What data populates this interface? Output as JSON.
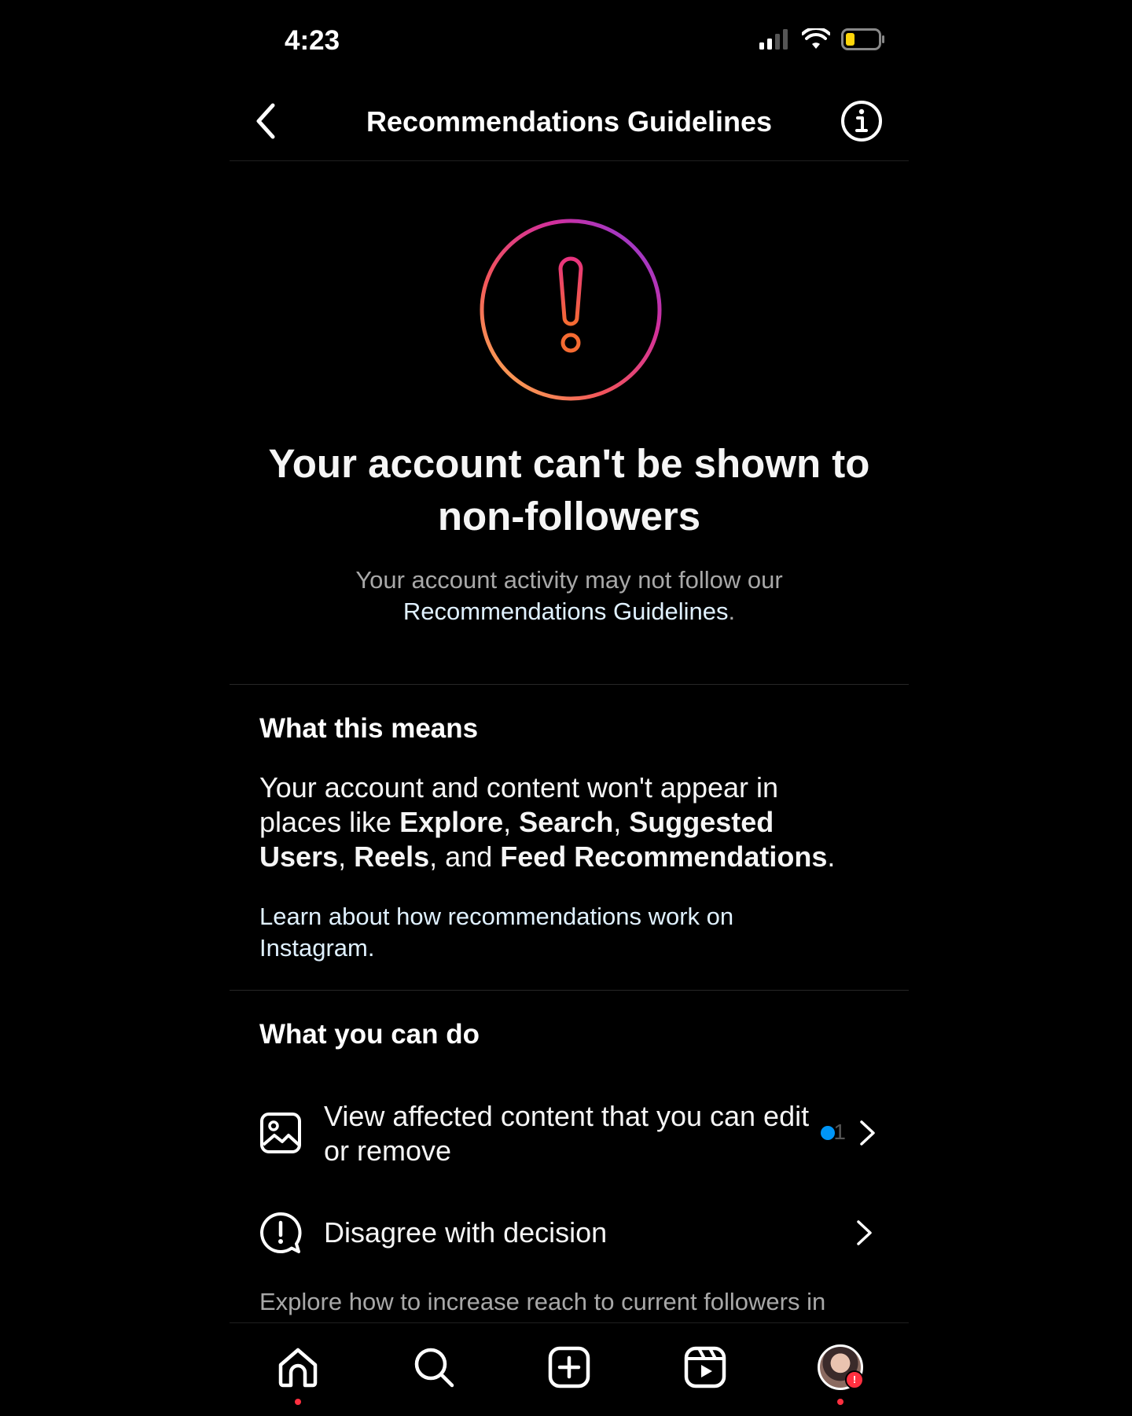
{
  "status_bar": {
    "time": "4:23"
  },
  "header": {
    "title": "Recommendations Guidelines"
  },
  "hero": {
    "title": "Your account can't be shown to non-followers",
    "subtitle_prefix": "Your account activity may not follow our",
    "subtitle_link": "Recommendations Guidelines",
    "subtitle_suffix": "."
  },
  "means": {
    "title": "What this means",
    "body_1": "Your account and content won't appear in places like ",
    "explore": "Explore",
    "sep1": ", ",
    "search": "Search",
    "sep2": ", ",
    "suggested_users": "Suggested Users",
    "sep3": ", ",
    "reels": "Reels",
    "sep4": ", and ",
    "feed_recs": "Feed Recommendations",
    "end": ".",
    "learn_link": "Learn about how recommendations work on Instagram."
  },
  "actions": {
    "title": "What you can do",
    "view_affected": {
      "label": "View affected content that you can edit or remove",
      "count": "1"
    },
    "disagree": {
      "label": "Disagree with decision"
    },
    "explore_text": "Explore how to increase reach to current followers in"
  },
  "colors": {
    "accent_blue": "#0095f6",
    "notification_red": "#ff3040",
    "link": "#e0f1ff"
  },
  "icons": {
    "back": "chevron-left-icon",
    "info": "info-icon",
    "hero": "warning-exclamation-icon",
    "view": "image-icon",
    "disagree": "alert-bubble-icon",
    "tabs": [
      "home-icon",
      "search-icon",
      "create-icon",
      "reels-icon",
      "profile-avatar"
    ]
  }
}
